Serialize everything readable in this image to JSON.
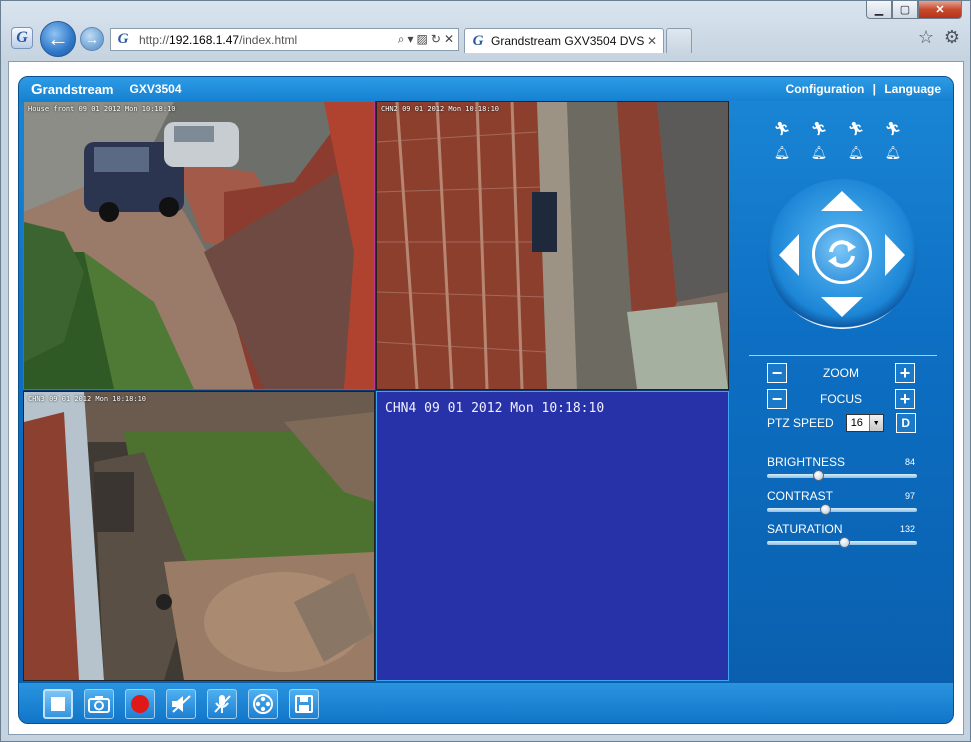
{
  "browser": {
    "url_prefix": "http://",
    "url_host": "192.168.1.47",
    "url_path": "/index.html",
    "tab_title": "Grandstream GXV3504 DVS",
    "tab_close": "✕",
    "logo_letter": "G"
  },
  "app": {
    "brand_first": "G",
    "brand_rest": "randstream",
    "model": "GXV3504",
    "links": {
      "configuration": "Configuration",
      "separator": "|",
      "language": "Language"
    }
  },
  "channels": [
    {
      "osd": "House front  09 01 2012 Mon 10:18:10"
    },
    {
      "osd": "CHN2  09 01 2012 Mon 10:18:10"
    },
    {
      "osd": "CHN3  09 01 2012 Mon 10:18:10"
    },
    {
      "osd": "CHN4   09 01 2012 Mon 10:18:10"
    }
  ],
  "ptz": {
    "zoom_label": "ZOOM",
    "focus_label": "FOCUS",
    "speed_label": "PTZ SPEED",
    "speed_value": "16",
    "d_label": "D",
    "minus": "−",
    "plus": "+"
  },
  "image_controls": {
    "brightness": {
      "label": "BRIGHTNESS",
      "value": 84,
      "max": 255
    },
    "contrast": {
      "label": "CONTRAST",
      "value": 97,
      "max": 255
    },
    "saturation": {
      "label": "SATURATION",
      "value": 132,
      "max": 255
    }
  },
  "colors": {
    "accent": "#0d6fc3",
    "chn4_bg": "#2832a8",
    "selected_border": "#c2368f",
    "record_red": "#e01818"
  }
}
